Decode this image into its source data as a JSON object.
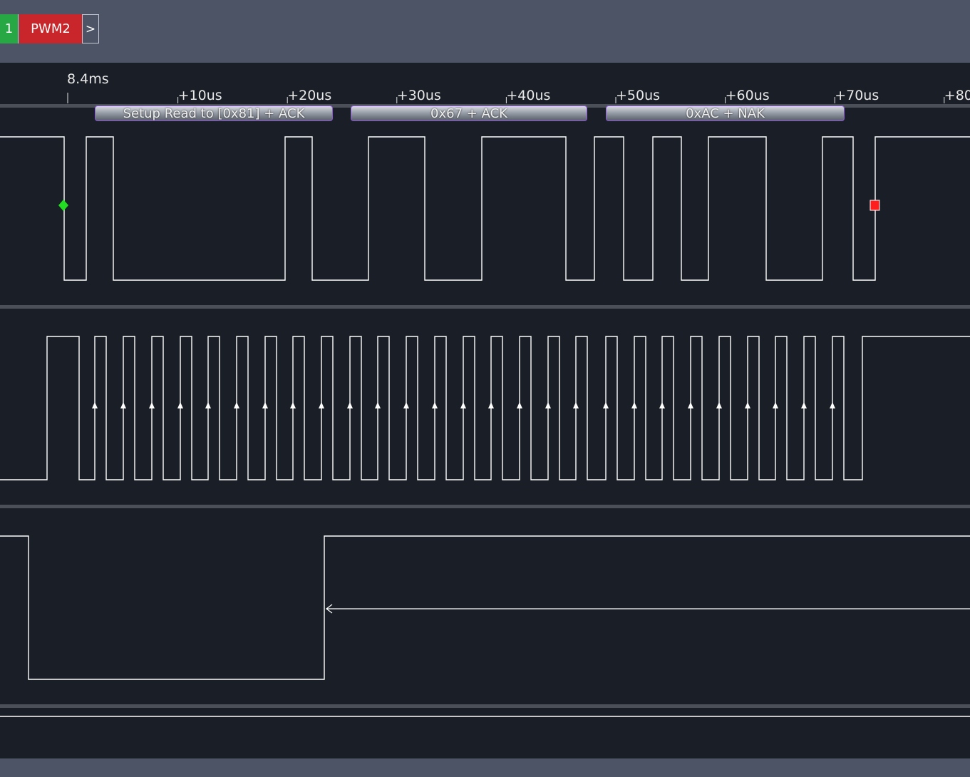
{
  "tabs": {
    "channel1_label": "1",
    "pwm2_label": "PWM2",
    "next_label": ">"
  },
  "timeline": {
    "start_label": "8.4ms",
    "ticks": [
      "+10us",
      "+20us",
      "+30us",
      "+40us",
      "+50us",
      "+60us",
      "+70us",
      "+80"
    ]
  },
  "decoder": {
    "labels": [
      "Setup Read to [0x81] + ACK",
      "0x67 + ACK",
      "0xAC + NAK"
    ]
  },
  "colors": {
    "background": "#1a1f27",
    "toolbar": "#4d5466",
    "channel1_tab": "#27a844",
    "pwm2_tab": "#c8262a",
    "trace": "#ffffff",
    "decoder_border": "#8e5ad8",
    "start_marker": "#22dd22",
    "stop_marker": "#ff1e1e"
  }
}
